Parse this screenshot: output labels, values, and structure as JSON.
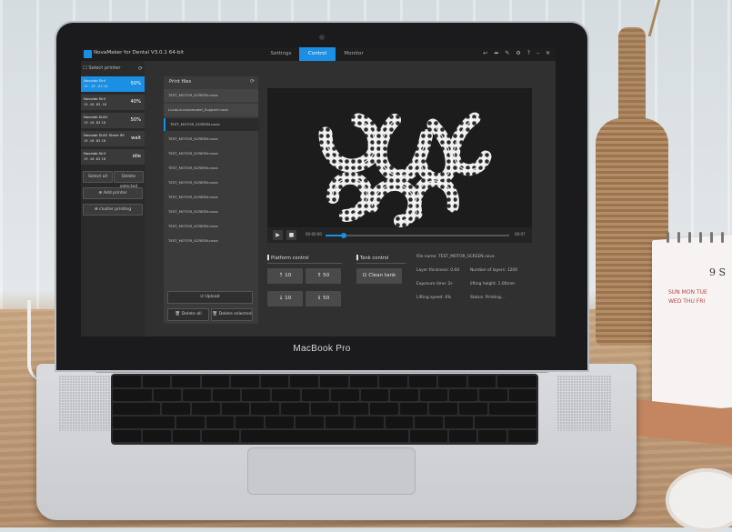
{
  "device": {
    "brand": "MacBook Pro"
  },
  "calendar": {
    "month": "9 S",
    "days": [
      "SUN",
      "MON",
      "TUE",
      "WED",
      "THU",
      "FRI"
    ]
  },
  "app": {
    "title": "NovaMaker for Dental V3.0.1 64-bit",
    "tabs": [
      {
        "label": "Settings",
        "active": false
      },
      {
        "label": "Control",
        "active": true
      },
      {
        "label": "Monitor",
        "active": false
      }
    ],
    "window_icons": [
      "arrow-left-icon",
      "arrow-right-icon",
      "edit-icon",
      "gear-icon",
      "help-icon",
      "minimize-icon",
      "close-icon"
    ]
  },
  "sidebar": {
    "header": "Select printer",
    "printers": [
      {
        "name": "Novalab Slnf",
        "ip": "19 , 16 .:83 18",
        "status": "50%",
        "active": true
      },
      {
        "name": "Novalab Slnf",
        "ip": "19 .16 .83 .18",
        "status": "40%",
        "active": false
      },
      {
        "name": "Novalab SLN1",
        "ip": "19 .16 .83 18",
        "status": "50%",
        "active": false
      },
      {
        "name": "Novalab SLN1 Share 99",
        "ip": "19 .16 .83 18",
        "status": "wait",
        "active": false
      },
      {
        "name": "Novalab Slnf",
        "ip": "19 .16 .83 18",
        "status": "idle",
        "active": false
      }
    ],
    "buttons": {
      "select_all": "Select all",
      "delete_selected": "Delete selected",
      "add_printer": "Add printer",
      "cluster_printing": "cluster printing"
    }
  },
  "files": {
    "header": "Print files",
    "items": [
      {
        "name": "TEST_MOTOR_SCREEN.nova",
        "selected": false
      },
      {
        "name": "Lucas.b.novamodel_Support.nova",
        "selected": false
      },
      {
        "name": "TEST_MOTOR_SCREEN.nova",
        "selected": true
      },
      {
        "name": "TEST_MOTOR_SCREEN.nova",
        "selected": false
      },
      {
        "name": "TEST_MOTOR_SCREEN.nova",
        "selected": false
      },
      {
        "name": "TEST_MOTOR_SCREEN.nova",
        "selected": false
      },
      {
        "name": "TEST_MOTOR_SCREEN.nova",
        "selected": false
      },
      {
        "name": "TEST_MOTOR_SCREEN.nova",
        "selected": false
      },
      {
        "name": "TEST_MOTOR_SCREEN.nova",
        "selected": false
      },
      {
        "name": "TEST_MOTOR_SCREEN.nova",
        "selected": false
      },
      {
        "name": "TEST_MOTOR_SCREEN.nova",
        "selected": false
      }
    ],
    "buttons": {
      "upload": "Upload",
      "delete_all": "Delete all",
      "delete_selected": "Delete selected"
    }
  },
  "player": {
    "time_current": "00:00:00",
    "time_total": "00:07",
    "progress": 0.1
  },
  "platform": {
    "title": "Platform control",
    "up10": "10",
    "up50": "50",
    "down10": "10",
    "down50": "50"
  },
  "tank": {
    "title": "Tank control",
    "clean": "Clean tank"
  },
  "info": {
    "file_name": "File name: TEST_MOTOR_SCREEN.nova",
    "layer_thickness": "Layer thickness: 0.04",
    "num_layers": "Number of layers: 1200",
    "exposure_time": "Exposure time: 2s",
    "lifting_height": "lifting height: 1.00mm",
    "lifting_speed": "Lifting speed: 4%",
    "status": "Status: Printing..."
  }
}
